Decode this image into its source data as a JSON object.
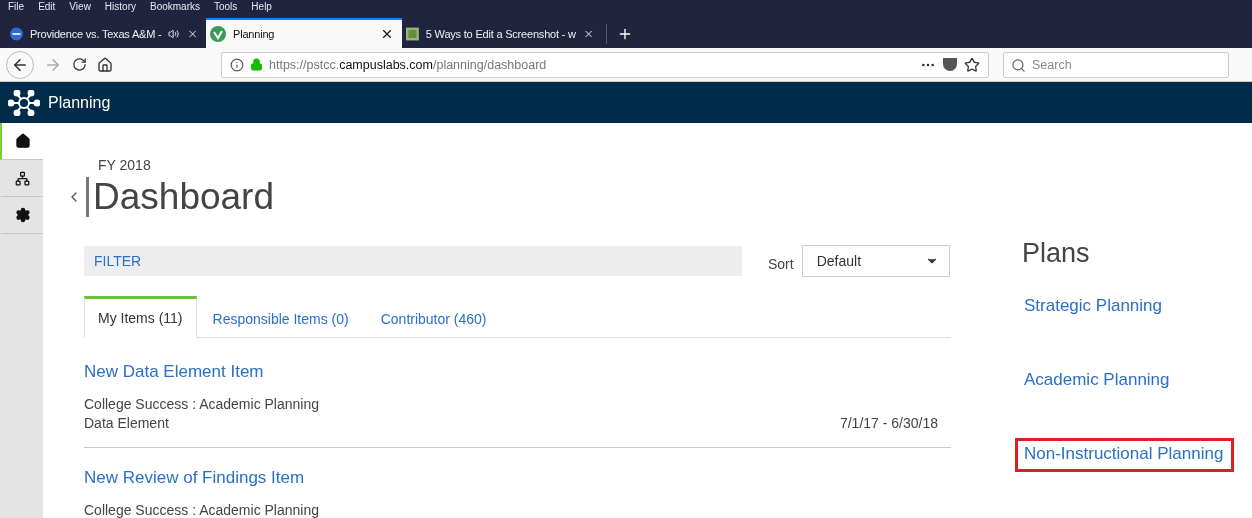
{
  "menu_bar": [
    "File",
    "Edit",
    "View",
    "History",
    "Bookmarks",
    "Tools",
    "Help"
  ],
  "browser_tabs": [
    {
      "title": "Providence vs. Texas A&M -",
      "selected": false,
      "audio": true,
      "kind": "sports"
    },
    {
      "title": "Planning",
      "selected": true,
      "audio": false,
      "kind": "planning"
    },
    {
      "title": "5 Ways to Edit a Screenshot - w",
      "selected": false,
      "audio": false,
      "kind": "wikihow"
    }
  ],
  "address_bar": {
    "url_prefix": "https://pstcc.",
    "url_domain": "campuslabs.com",
    "url_path": "/planning/dashboard"
  },
  "search": {
    "placeholder": "Search"
  },
  "app": {
    "title": "Planning"
  },
  "side_nav": [
    {
      "kind": "home",
      "selected": true
    },
    {
      "kind": "hierarchy",
      "selected": false
    },
    {
      "kind": "settings",
      "selected": false
    }
  ],
  "dashboard": {
    "fiscal_year": "FY 2018",
    "title": "Dashboard",
    "filter": "FILTER",
    "sort_label": "Sort",
    "sort_value": "Default"
  },
  "item_tabs": [
    {
      "label": "My Items (11)",
      "selected": true
    },
    {
      "label": "Responsible Items (0)",
      "selected": false
    },
    {
      "label": "Contributor (460)",
      "selected": false
    }
  ],
  "items": [
    {
      "title": "New Data Element Item",
      "path": "College Success : Academic Planning",
      "type": "Data Element",
      "dates": "7/1/17 - 6/30/18"
    },
    {
      "title": "New Review of Findings Item",
      "path": "College Success : Academic Planning"
    }
  ],
  "plans": {
    "heading": "Plans",
    "items": [
      {
        "label": "Strategic Planning",
        "highlighted": false
      },
      {
        "label": "Academic Planning",
        "highlighted": false
      },
      {
        "label": "Non-Instructional Planning",
        "highlighted": true
      }
    ]
  }
}
